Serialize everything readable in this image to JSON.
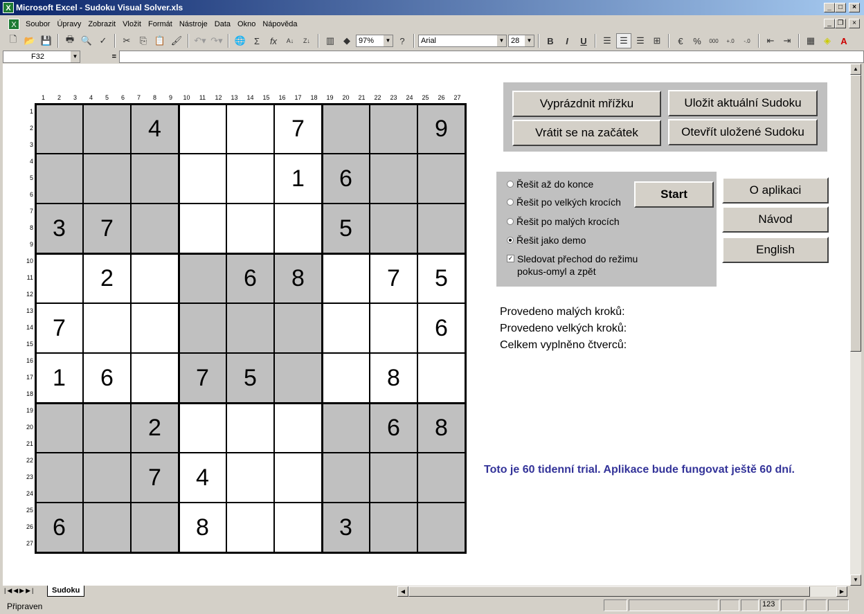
{
  "window": {
    "title": "Microsoft Excel - Sudoku Visual Solver.xls",
    "app_icon": "X"
  },
  "menu": [
    "Soubor",
    "Úpravy",
    "Zobrazit",
    "Vložit",
    "Formát",
    "Nástroje",
    "Data",
    "Okno",
    "Nápověda"
  ],
  "toolbar": {
    "zoom": "97%",
    "font": "Arial",
    "font_size": "28",
    "bold": "B",
    "italic": "I",
    "underline": "U",
    "percent": "%",
    "thousands": "000"
  },
  "formula_bar": {
    "name_box": "F32",
    "equals": "=",
    "value": ""
  },
  "grid": {
    "col_headers": [
      "1",
      "2",
      "3",
      "4",
      "5",
      "6",
      "7",
      "8",
      "9",
      "10",
      "11",
      "12",
      "13",
      "14",
      "15",
      "16",
      "17",
      "18",
      "19",
      "20",
      "21",
      "22",
      "23",
      "24",
      "25",
      "26",
      "27"
    ],
    "row_headers": [
      "1",
      "2",
      "3",
      "4",
      "5",
      "6",
      "7",
      "8",
      "9",
      "10",
      "11",
      "12",
      "13",
      "14",
      "15",
      "16",
      "17",
      "18",
      "19",
      "20",
      "21",
      "22",
      "23",
      "24",
      "25",
      "26",
      "27"
    ],
    "cells": [
      [
        "",
        "",
        "4",
        "",
        "",
        "7",
        "",
        "",
        "9"
      ],
      [
        "",
        "",
        "",
        "",
        "",
        "1",
        "6",
        "",
        ""
      ],
      [
        "3",
        "7",
        "",
        "",
        "",
        "",
        "5",
        "",
        ""
      ],
      [
        "",
        "2",
        "",
        "",
        "6",
        "8",
        "",
        "7",
        "5"
      ],
      [
        "7",
        "",
        "",
        "",
        "",
        "",
        "",
        "",
        "6"
      ],
      [
        "1",
        "6",
        "",
        "7",
        "5",
        "",
        "",
        "8",
        ""
      ],
      [
        "",
        "",
        "2",
        "",
        "",
        "",
        "",
        "6",
        "8"
      ],
      [
        "",
        "",
        "7",
        "4",
        "",
        "",
        "",
        "",
        ""
      ],
      [
        "6",
        "",
        "",
        "8",
        "",
        "",
        "3",
        "",
        ""
      ]
    ]
  },
  "buttons": {
    "clear": "Vyprázdnit mřížku",
    "save": "Uložit aktuální Sudoku",
    "restart": "Vrátit se na začátek",
    "open": "Otevřít uložené Sudoku",
    "start": "Start",
    "about": "O aplikaci",
    "guide": "Návod",
    "english": "English"
  },
  "options": [
    {
      "label": "Řešit až do konce",
      "selected": false
    },
    {
      "label": "Řešit po velkých krocích",
      "selected": false
    },
    {
      "label": "Řešit po malých krocích",
      "selected": false
    },
    {
      "label": "Řešit jako demo",
      "selected": true
    }
  ],
  "checkbox": {
    "label_line1": "Sledovat přechod do režimu",
    "label_line2": "pokus-omyl a zpět",
    "checked": true,
    "mark": "✓"
  },
  "stats": [
    "Provedeno malých kroků:",
    "Provedeno velkých kroků:",
    "Celkem vyplněno čtverců:"
  ],
  "trial": {
    "text": "Toto je 60 tidenní trial. Aplikace bude fungovat ještě 60 dní.",
    "color": "#333399"
  },
  "sheet_tab": "Sudoku",
  "status": {
    "text": "Připraven",
    "num": "123"
  }
}
